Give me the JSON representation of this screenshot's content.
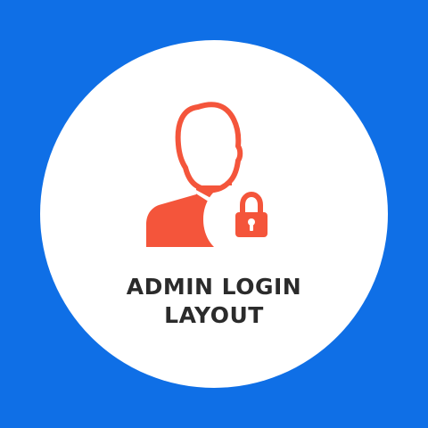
{
  "title_lines": [
    "ADMIN LOGIN",
    "LAYOUT"
  ],
  "icon": {
    "name": "admin-user-lock-icon",
    "color": "#f4553b"
  },
  "colors": {
    "background": "#0f6fe6",
    "circle": "#ffffff",
    "text": "#2b2b2b"
  }
}
